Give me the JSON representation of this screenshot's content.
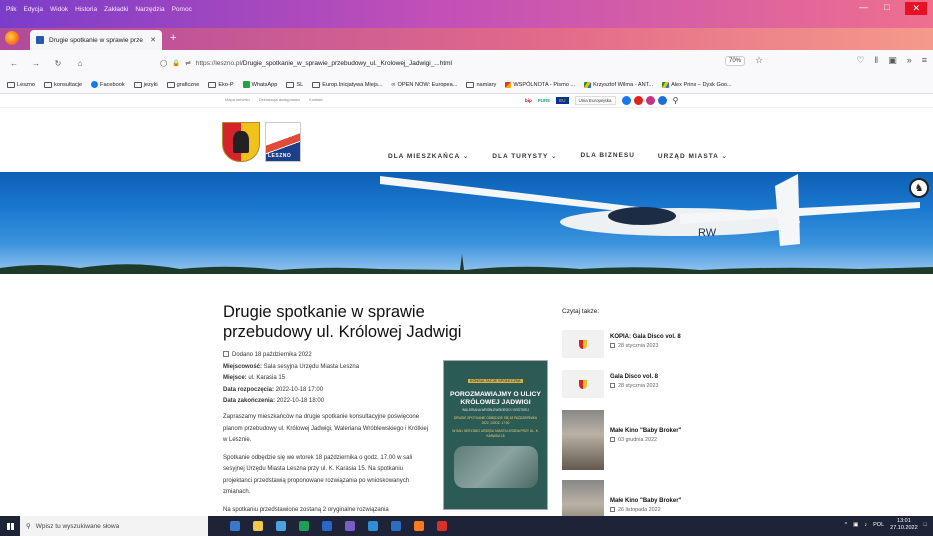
{
  "browser": {
    "menu": [
      "Plik",
      "Edycja",
      "Widok",
      "Historia",
      "Zakładki",
      "Narzędzia",
      "Pomoc"
    ],
    "tab_title": "Drugie spotkanie w sprawie prze",
    "url_host": "https://leszno.pl",
    "url_path": "/Drugie_spotkanie_w_sprawie_przebudowy_ul._Krolowej_Jadwigi_...html",
    "zoom": "70%",
    "bookmarks": [
      "Leszno",
      "konsultacje",
      "Facebook",
      "jezyki",
      "graficzne",
      "Eko-P",
      "WhatsApp",
      "SL",
      "Europ.Inicjatywa Miejs...",
      "OPEN NOW: Europea...",
      "namiary",
      "WSPÓLNOTA - Pismo ...",
      "Krzysztof Wilma - ANT...",
      "Alex Prins – Dysk Goo..."
    ]
  },
  "site": {
    "top_links": [
      "Mapa serwisu",
      "Deklaracja dostępności",
      "Kontakt"
    ],
    "logo_text": "LESZNO",
    "badges": {
      "bip": "bip",
      "pure": "PURE",
      "eu": "EU",
      "ue": "Unia Europejska"
    },
    "nav": [
      "DLA MIESZKAŃCA ⌄",
      "DLA TURYSTY ⌄",
      "DLA BIZNESU",
      "URZĄD MIASTA ⌄"
    ],
    "colors": {
      "hero": "#1a78cf",
      "poster": "#2c5b55",
      "taskbar": "#1f2337"
    }
  },
  "article": {
    "title_line1": "Drugie spotkanie w sprawie",
    "title_line2": "przebudowy ul. Królowej Jadwigi",
    "added": "Dodano 18 października 2022",
    "place_label": "Miejscowość:",
    "place_value": " Sala sesyjna Urzędu Miasta Leszna",
    "where_label": "Miejsce:",
    "where_value": " ul. Karasia 15",
    "start_label": "Data rozpoczęcia:",
    "start_value": " 2022-10-18 17:00",
    "end_label": "Data zakończenia:",
    "end_value": " 2022-10-18 18:00",
    "p1": "Zapraszamy mieszkańców na drugie spotkanie konsultacyjne poświęcone planom przebudowy ul. Królowej Jadwigi, Waleriana Wróblewskiego i Krótkiej w Lesznie.",
    "p2": "Spotkanie odbędzie się we wtorek 18 października o godz. 17.00 w sali sesyjnej Urzędu Miasta Leszna przy ul. K. Karasia 15. Na spotkaniu projektanci przedstawią proponowane rozwiązania po wnioskowanych zmianach.",
    "p3": "Na spotkaniu przedstawione zostaną 2 oryginalne rozwiązania"
  },
  "poster": {
    "tag": "KONSULTACJE SPOŁECZNE",
    "headline": "POROZMAWIAJMY O ULICY KRÓLOWEJ JADWIGI",
    "sub": "WALERIANA WRÓBLEWSKIEGO I KRÓTKIEJ",
    "when": "DRUGIE SPOTKANIE ODBĘDZIE SIĘ 18 PAŹDZIERNIKA 2022, GODZ. 17:00",
    "where": "W SALI SESYJNEJ URZĘDU MIASTA LESZNA PRZY UL. K. KARASIA 15"
  },
  "sidebar": {
    "heading": "Czytaj także:",
    "items": [
      {
        "title": "KOPIA: Gala Disco vol. 8",
        "date": "28 stycznia 2023"
      },
      {
        "title": "Gala Disco vol. 8",
        "date": "28 stycznia 2023"
      },
      {
        "title": "Małe Kino \"Baby Broker\"",
        "date": "03 grudnia 2022"
      },
      {
        "title": "Małe Kino \"Baby Broker\"",
        "date": "26 listopada 2022"
      }
    ]
  },
  "taskbar": {
    "search_placeholder": "Wpisz tu wyszukiwane słowa",
    "lang": "POL",
    "time": "13:01",
    "date": "27.10.2022"
  }
}
